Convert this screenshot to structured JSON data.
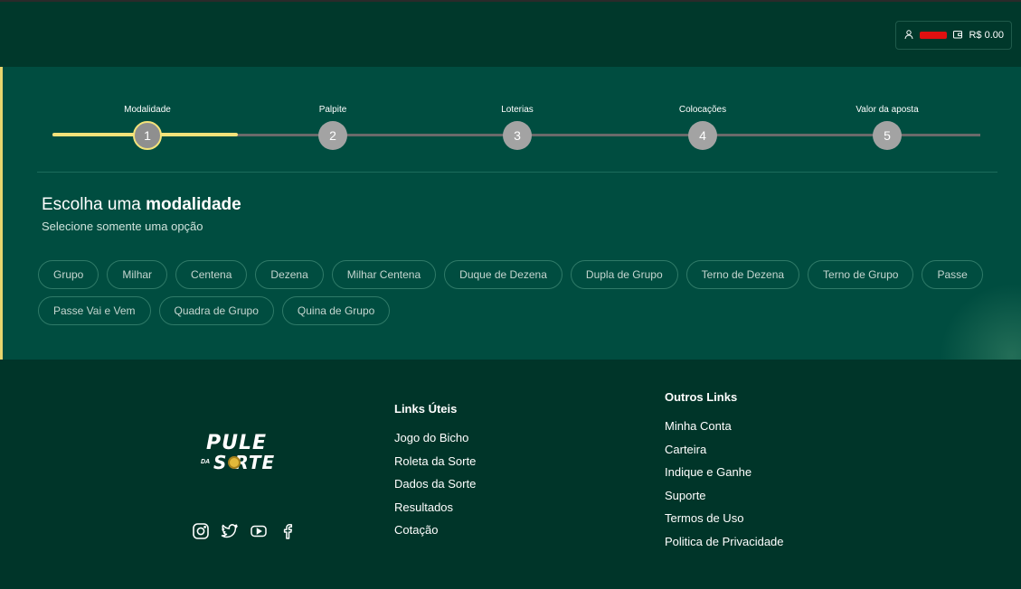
{
  "header": {
    "balance": "R$ 0.00",
    "icons": [
      "user-icon",
      "wallet-icon"
    ]
  },
  "stepper": {
    "progress_fraction": 0.2,
    "steps": [
      {
        "label": "Modalidade",
        "number": "1",
        "active": true
      },
      {
        "label": "Palpite",
        "number": "2",
        "active": false
      },
      {
        "label": "Loterias",
        "number": "3",
        "active": false
      },
      {
        "label": "Colocações",
        "number": "4",
        "active": false
      },
      {
        "label": "Valor da aposta",
        "number": "5",
        "active": false
      }
    ]
  },
  "section": {
    "title_prefix": "Escolha uma ",
    "title_bold": "modalidade",
    "subtitle": "Selecione somente uma opção"
  },
  "options": [
    "Grupo",
    "Milhar",
    "Centena",
    "Dezena",
    "Milhar Centena",
    "Duque de Dezena",
    "Dupla de Grupo",
    "Terno de Dezena",
    "Terno de Grupo",
    "Passe",
    "Passe Vai e Vem",
    "Quadra de Grupo",
    "Quina de Grupo"
  ],
  "footer": {
    "logo": {
      "top": "PULE",
      "da": "DA",
      "bottom": "S RTE"
    },
    "socials": [
      "instagram-icon",
      "twitter-icon",
      "youtube-icon",
      "facebook-icon"
    ],
    "links_uteis": {
      "title": "Links Úteis",
      "items": [
        "Jogo do Bicho",
        "Roleta da Sorte",
        "Dados da Sorte",
        "Resultados",
        "Cotação"
      ]
    },
    "outros_links": {
      "title": "Outros Links",
      "items": [
        "Minha Conta",
        "Carteira",
        "Indique e Ganhe",
        "Suporte",
        "Termos de Uso",
        "Politica de Privacidade"
      ]
    }
  },
  "colors": {
    "header_bg": "#00382b",
    "panel_bg": "#004d40",
    "footer_bg": "#003529",
    "accent": "#f3e27a",
    "step_circle": "#a3a3a3"
  }
}
